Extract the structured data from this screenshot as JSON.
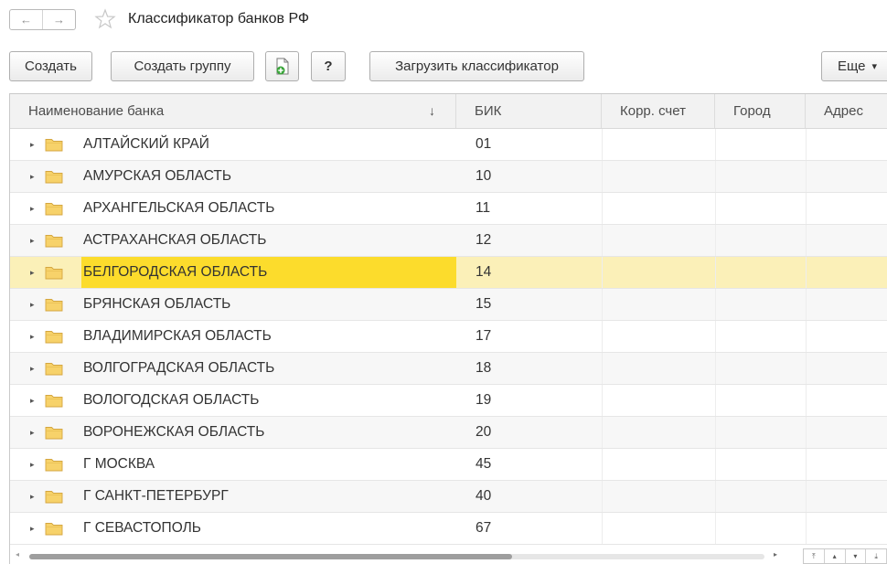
{
  "window": {
    "title": "Классификатор банков РФ"
  },
  "nav": {
    "back_icon": "←",
    "forward_icon": "→"
  },
  "toolbar": {
    "create_label": "Создать",
    "create_group_label": "Создать группу",
    "help_label": "?",
    "load_label": "Загрузить классификатор",
    "more_label": "Еще",
    "more_arrow": "▾"
  },
  "table": {
    "columns": {
      "name": "Наименование банка",
      "sort_indicator": "↓",
      "bik": "БИК",
      "corr": "Корр. счет",
      "city": "Город",
      "address": "Адрес"
    },
    "expander_glyph": "▸",
    "rows": [
      {
        "name": "АЛТАЙСКИЙ КРАЙ",
        "bik": "01"
      },
      {
        "name": "АМУРСКАЯ ОБЛАСТЬ",
        "bik": "10"
      },
      {
        "name": "АРХАНГЕЛЬСКАЯ ОБЛАСТЬ",
        "bik": "11"
      },
      {
        "name": "АСТРАХАНСКАЯ ОБЛАСТЬ",
        "bik": "12"
      },
      {
        "name": "БЕЛГОРОДСКАЯ ОБЛАСТЬ",
        "bik": "14",
        "selected": true
      },
      {
        "name": "БРЯНСКАЯ ОБЛАСТЬ",
        "bik": "15"
      },
      {
        "name": "ВЛАДИМИРСКАЯ ОБЛАСТЬ",
        "bik": "17"
      },
      {
        "name": "ВОЛГОГРАДСКАЯ ОБЛАСТЬ",
        "bik": "18"
      },
      {
        "name": "ВОЛОГОДСКАЯ ОБЛАСТЬ",
        "bik": "19"
      },
      {
        "name": "ВОРОНЕЖСКАЯ ОБЛАСТЬ",
        "bik": "20"
      },
      {
        "name": "Г МОСКВА",
        "bik": "45"
      },
      {
        "name": "Г САНКТ-ПЕТЕРБУРГ",
        "bik": "40"
      },
      {
        "name": "Г СЕВАСТОПОЛЬ",
        "bik": "67"
      }
    ]
  },
  "scrollbar": {
    "left_arrow": "◂",
    "right_arrow": "▸"
  },
  "pager": {
    "first": "⤒",
    "up": "▴",
    "down": "▾",
    "last": "⤓"
  },
  "colors": {
    "selection_cell": "#fcdc2c",
    "selection_row": "#fbf0b8",
    "folder": "#f7d26a",
    "accent_green": "#3aa53a"
  }
}
